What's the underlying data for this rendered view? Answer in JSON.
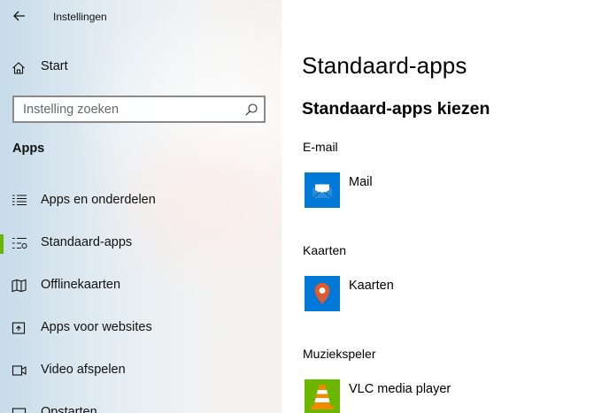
{
  "window": {
    "title": "Instellingen"
  },
  "sidebar": {
    "start_label": "Start",
    "search": {
      "placeholder": "Instelling zoeken"
    },
    "section_title": "Apps",
    "items": [
      {
        "label": "Apps en onderdelen",
        "icon": "apps-list-icon",
        "selected": false
      },
      {
        "label": "Standaard-apps",
        "icon": "default-apps-icon",
        "selected": true
      },
      {
        "label": "Offlinekaarten",
        "icon": "map-icon",
        "selected": false
      },
      {
        "label": "Apps voor websites",
        "icon": "open-link-icon",
        "selected": false
      },
      {
        "label": "Video afspelen",
        "icon": "video-icon",
        "selected": false
      },
      {
        "label": "Opstarten",
        "icon": "startup-icon",
        "selected": false
      }
    ]
  },
  "main": {
    "title": "Standaard-apps",
    "subtitle": "Standaard-apps kiezen",
    "categories": [
      {
        "label": "E-mail",
        "app": "Mail",
        "icon": "mail-icon",
        "color": "#0078d7"
      },
      {
        "label": "Kaarten",
        "app": "Kaarten",
        "icon": "maps-pin-icon",
        "color": "#0078d7"
      },
      {
        "label": "Muziekspeler",
        "app": "VLC media player",
        "icon": "vlc-cone-icon",
        "color": "#6bb700"
      }
    ]
  },
  "colors": {
    "accent": "#0078d7",
    "selection": "#6bb700"
  }
}
